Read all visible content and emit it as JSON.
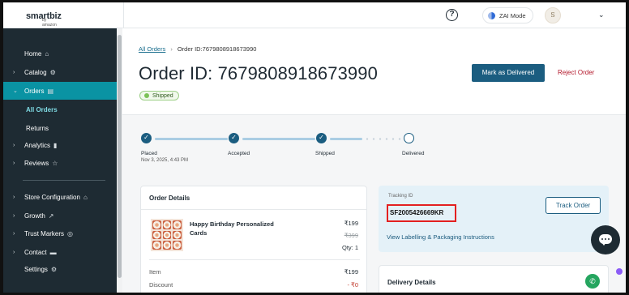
{
  "app": {
    "logo_text": "smartbiz",
    "logo_sub": "by amazon"
  },
  "topbar": {
    "help_icon": "?",
    "zai_label": "ZAI Mode",
    "avatar_initial": "S"
  },
  "sidebar": {
    "items": [
      {
        "label": "Home",
        "icon": "⌂",
        "arrow": ""
      },
      {
        "label": "Catalog",
        "icon": "⚙",
        "arrow": "›"
      },
      {
        "label": "Orders",
        "icon": "▤",
        "arrow": "⌄"
      },
      {
        "label": "Analytics",
        "icon": "▮",
        "arrow": "›"
      },
      {
        "label": "Reviews",
        "icon": "☆",
        "arrow": "›"
      },
      {
        "label": "Store Configuration",
        "icon": "⌂",
        "arrow": "›"
      },
      {
        "label": "Growth",
        "icon": "↗",
        "arrow": "›"
      },
      {
        "label": "Trust Markers",
        "icon": "◎",
        "arrow": "›"
      },
      {
        "label": "Contact",
        "icon": "▬",
        "arrow": "›"
      },
      {
        "label": "Settings",
        "icon": "⚙",
        "arrow": ""
      }
    ],
    "sub_items": [
      "All Orders",
      "Returns"
    ]
  },
  "breadcrumb": {
    "link": "All Orders",
    "sep": "›",
    "current": "Order ID:7679808918673990"
  },
  "order": {
    "title": "Order ID: 7679808918673990",
    "status": "Shipped",
    "mark_delivered": "Mark as Delivered",
    "reject": "Reject Order"
  },
  "progress": {
    "steps": [
      {
        "label": "Placed",
        "date": "Nov 3, 2025, 4:43 PM",
        "state": "done"
      },
      {
        "label": "Accepted",
        "date": "",
        "state": "done"
      },
      {
        "label": "Shipped",
        "date": "",
        "state": "done"
      },
      {
        "label": "Delivered",
        "date": "",
        "state": "pending"
      }
    ]
  },
  "order_details": {
    "title": "Order Details",
    "product_name": "Happy Birthday Personalized Cards",
    "price": "₹199",
    "mrp": "₹399",
    "qty": "Qty: 1",
    "rows": [
      {
        "label": "Item",
        "value": "₹199"
      },
      {
        "label": "Discount",
        "value": "- ₹0"
      }
    ]
  },
  "tracking": {
    "label": "Tracking ID",
    "id": "SF2005426669KR",
    "button": "Track Order",
    "link": "View Labelling & Packaging Instructions"
  },
  "delivery": {
    "title": "Delivery Details"
  },
  "colors": {
    "sidebar": "#1e2b33",
    "active": "#0a93a3",
    "primary": "#1b5d80",
    "danger": "#b3172a"
  }
}
